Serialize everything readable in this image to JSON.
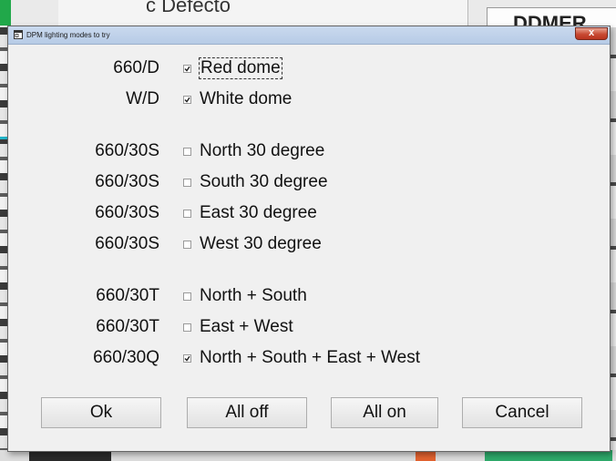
{
  "background": {
    "left_panel_text": "c  Defecto",
    "right_panel_text": "DDMER"
  },
  "dialog": {
    "title": "DPM lighting modes to try",
    "close_glyph": "x",
    "rows": [
      {
        "code": "660/D",
        "label": "Red dome",
        "checked": true
      },
      {
        "code": "W/D",
        "label": "White dome",
        "checked": true
      },
      {
        "code": "660/30S",
        "label": "North 30 degree",
        "checked": false
      },
      {
        "code": "660/30S",
        "label": "South 30 degree",
        "checked": false
      },
      {
        "code": "660/30S",
        "label": "East 30 degree",
        "checked": false
      },
      {
        "code": "660/30S",
        "label": "West 30 degree",
        "checked": false
      },
      {
        "code": "660/30T",
        "label": "North + South",
        "checked": false
      },
      {
        "code": "660/30T",
        "label": "East + West",
        "checked": false
      },
      {
        "code": "660/30Q",
        "label": "North + South + East + West",
        "checked": true
      }
    ],
    "buttons": {
      "ok": "Ok",
      "all_off": "All off",
      "all_on": "All on",
      "cancel": "Cancel"
    }
  }
}
